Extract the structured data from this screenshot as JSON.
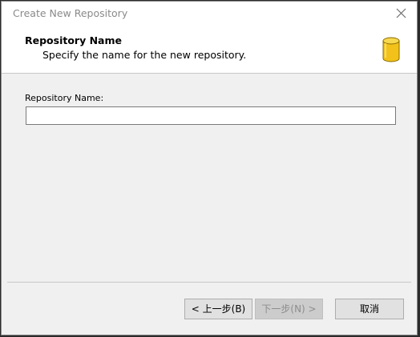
{
  "window": {
    "title": "Create New Repository"
  },
  "header": {
    "title": "Repository Name",
    "subtitle": "Specify the name for the new repository."
  },
  "form": {
    "name_label": "Repository Name:",
    "name_value": ""
  },
  "buttons": {
    "back_label": "< 上一步(B)",
    "next_label": "下一步(N) >",
    "next_enabled": false,
    "cancel_label": "取消"
  },
  "icons": {
    "close": "close-icon",
    "repository": "database-icon"
  },
  "colors": {
    "icon_fill": "#f2c21a",
    "icon_stroke": "#8a6b00"
  }
}
